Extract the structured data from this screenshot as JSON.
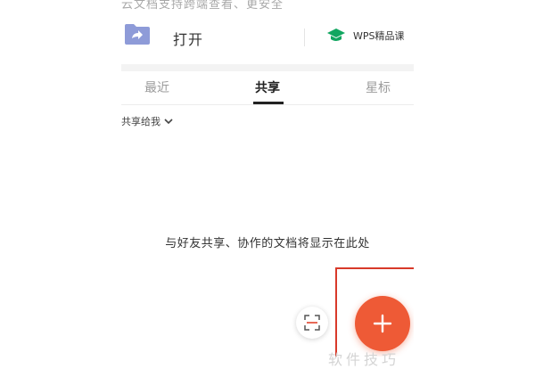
{
  "banner": {
    "text": "云文档支持跨端查看、更安全"
  },
  "header": {
    "open_label": "打开",
    "wps_course_label": "WPS精品课"
  },
  "tabs": [
    {
      "label": "最近",
      "active": false
    },
    {
      "label": "共享",
      "active": true
    },
    {
      "label": "星标",
      "active": false
    }
  ],
  "filter": {
    "label": "共享给我"
  },
  "empty_state": {
    "message": "与好友共享、协作的文档将显示在此处"
  },
  "watermark": {
    "text": "软件技巧"
  },
  "colors": {
    "fab": "#ee5a36",
    "highlight": "#d83a2a",
    "folder": "#8e9bd8",
    "wps_cap": "#11a660"
  },
  "icons": [
    "folder-share-icon",
    "graduation-cap-icon",
    "chevron-down-icon",
    "scan-icon",
    "plus-icon"
  ]
}
